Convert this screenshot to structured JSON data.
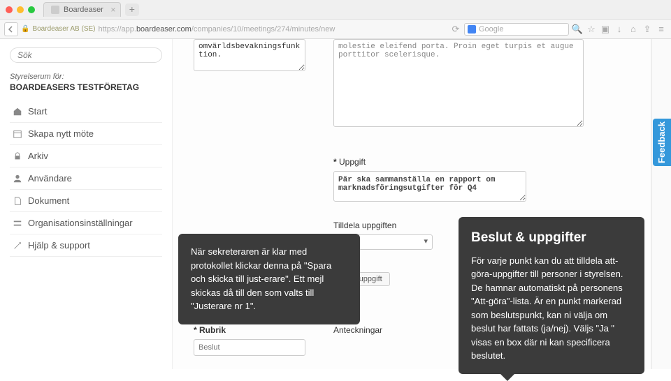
{
  "browser": {
    "tab_title": "Boardeaser",
    "company_badge": "Boardeaser AB (SE)",
    "url_prefix": "https://app.",
    "url_domain": "boardeaser.com",
    "url_path": "/companies/10/meetings/274/minutes/new",
    "search_placeholder": "Google"
  },
  "sidebar": {
    "search_placeholder": "Sök",
    "boardroom_label": "Styrelserum för:",
    "company_name": "BOARDEASERS TESTFÖRETAG",
    "items": [
      {
        "label": "Start",
        "icon": "home"
      },
      {
        "label": "Skapa nytt möte",
        "icon": "calendar"
      },
      {
        "label": "Arkiv",
        "icon": "lock"
      },
      {
        "label": "Användare",
        "icon": "user"
      },
      {
        "label": "Dokument",
        "icon": "file"
      },
      {
        "label": "Organisationsinställningar",
        "icon": "settings"
      },
      {
        "label": "Hjälp & support",
        "icon": "help"
      }
    ]
  },
  "form": {
    "left_textarea_value": "omvärldsbevakningsfunktion.",
    "right_textarea_value": "molestie eleifend porta. Proin eget turpis et augue porttitor scelerisque.",
    "task_label": "* Uppgift",
    "task_value": "Pär ska sammanställa en rapport om marknadsföringsutgifter för Q4",
    "assign_label": "Tilldela uppgiften",
    "add_task_button": "göra-uppgift",
    "rubrik_label": "* Rubrik",
    "rubrik_placeholder": "Beslut",
    "anteckningar_label": "Anteckningar"
  },
  "callouts": {
    "protocol_text": "När sekreteraren är klar med protokollet klickar denna på \"Spara och skicka till just-erare\". Ett mejl skickas då till den som valts till \"Justerare nr 1\".",
    "decisions_title": "Beslut & uppgifter",
    "decisions_text": "För varje punkt kan du att tilldela att-göra-uppgifter till personer i styrelsen. De hamnar automatiskt på personens \"Att-göra\"-lista. Är en punkt markerad som beslutspunkt, kan ni välja om beslut har fattats (ja/nej). Väljs \"Ja \" visas en box där ni kan specificera beslutet."
  },
  "feedback_label": "Feedback"
}
